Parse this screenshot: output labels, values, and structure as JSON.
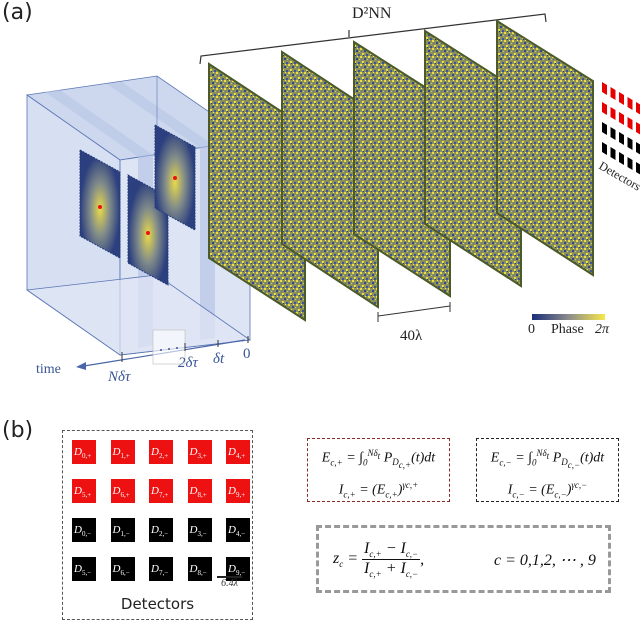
{
  "panel_a": {
    "label": "(a)",
    "network_label": "D²NN",
    "detectors_label": "Detectors",
    "time_axis": {
      "axis_label": "time",
      "ticks": [
        "Nδτ",
        "2δτ",
        "δt",
        "0"
      ]
    },
    "layer_spacing_label": "40λ",
    "colorbar": {
      "min_label": "0",
      "title": "Phase",
      "max_label": "2π",
      "color_low": "#1a2f78",
      "color_high": "#f5e84a"
    },
    "num_layers": 5,
    "detector_array_colors": [
      "#e60000",
      "#e60000",
      "#000000",
      "#000000"
    ]
  },
  "panel_b": {
    "label": "(b)",
    "detectors_title": "Detectors",
    "scale_bar": "6.4λ",
    "detectors": [
      {
        "name": "D",
        "sub": "0,+",
        "color": "#ee1111"
      },
      {
        "name": "D",
        "sub": "1,+",
        "color": "#ee1111"
      },
      {
        "name": "D",
        "sub": "2,+",
        "color": "#ee1111"
      },
      {
        "name": "D",
        "sub": "3,+",
        "color": "#ee1111"
      },
      {
        "name": "D",
        "sub": "4,+",
        "color": "#ee1111"
      },
      {
        "name": "D",
        "sub": "5,+",
        "color": "#ee1111"
      },
      {
        "name": "D",
        "sub": "6,+",
        "color": "#ee1111"
      },
      {
        "name": "D",
        "sub": "7,+",
        "color": "#ee1111"
      },
      {
        "name": "D",
        "sub": "8,+",
        "color": "#ee1111"
      },
      {
        "name": "D",
        "sub": "9,+",
        "color": "#ee1111"
      },
      {
        "name": "D",
        "sub": "0,−",
        "color": "#000000"
      },
      {
        "name": "D",
        "sub": "1,−",
        "color": "#000000"
      },
      {
        "name": "D",
        "sub": "2,−",
        "color": "#000000"
      },
      {
        "name": "D",
        "sub": "3,−",
        "color": "#000000"
      },
      {
        "name": "D",
        "sub": "4,−",
        "color": "#000000"
      },
      {
        "name": "D",
        "sub": "5,−",
        "color": "#000000"
      },
      {
        "name": "D",
        "sub": "6,−",
        "color": "#000000"
      },
      {
        "name": "D",
        "sub": "7,−",
        "color": "#000000"
      },
      {
        "name": "D",
        "sub": "8,−",
        "color": "#000000"
      },
      {
        "name": "D",
        "sub": "9,−",
        "color": "#000000"
      }
    ],
    "equations": {
      "plus_energy": "E_{c,+} = ∫₀^{Nδt} P_{D_{c,+}}(t) dt",
      "plus_intensity": "I_{c,+} = (E_{c,+})^{γc,+}",
      "minus_energy": "E_{c,−} = ∫₀^{Nδt} P_{D_{c,−}}(t) dt",
      "minus_intensity": "I_{c,−} = (E_{c,−})^{γc,−}",
      "output": "z_c = (I_{c,+} − I_{c,−}) / (I_{c,+} + I_{c,−}),",
      "index_range": "c = 0,1,2, ⋯ , 9"
    }
  }
}
